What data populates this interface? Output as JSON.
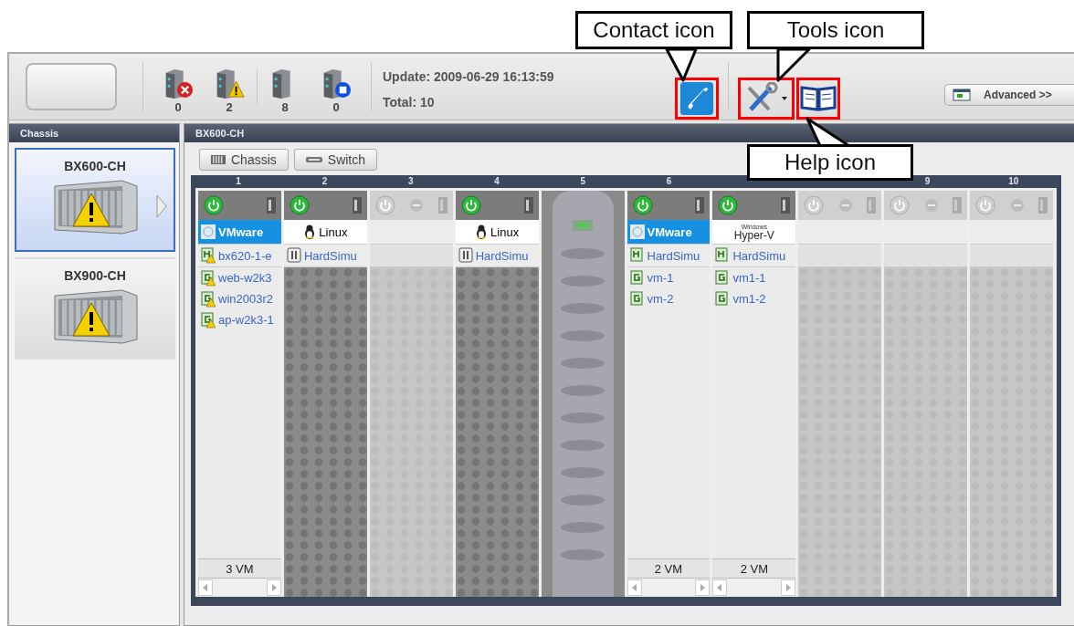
{
  "callouts": [
    {
      "text": "Contact icon"
    },
    {
      "text": "Tools icon"
    },
    {
      "text": "Help icon"
    }
  ],
  "toolbar": {
    "status_counts": [
      {
        "kind": "error",
        "count": "0"
      },
      {
        "kind": "warning",
        "count": "2"
      },
      {
        "kind": "normal",
        "count": "8"
      },
      {
        "kind": "stopped",
        "count": "0"
      }
    ],
    "update": "Update: 2009-06-29 16:13:59",
    "total": "Total: 10",
    "advanced_button": "Advanced >>"
  },
  "sidebar": {
    "title": "Chassis",
    "items": [
      {
        "label": "BX600-CH",
        "selected": true,
        "warning": true
      },
      {
        "label": "BX900-CH",
        "selected": false,
        "warning": true
      }
    ]
  },
  "main": {
    "title": "BX600-CH",
    "view_buttons": [
      {
        "kind": "chassis",
        "label": "Chassis"
      },
      {
        "kind": "switch",
        "label": "Switch"
      }
    ],
    "slots": [
      {
        "number": "1",
        "kind": "server",
        "powered": true,
        "os": {
          "kind": "vmware",
          "label": "VMware"
        },
        "host": {
          "kind": "hypervisor",
          "label": "bx620-1-e",
          "warning": true
        },
        "guests": [
          {
            "label": "web-w2k3",
            "warning": true
          },
          {
            "label": "win2003r2",
            "warning": true
          },
          {
            "label": "ap-w2k3-1",
            "warning": true
          }
        ],
        "vm_count": "3 VM"
      },
      {
        "number": "2",
        "kind": "server",
        "powered": true,
        "os": {
          "kind": "linux",
          "label": "Linux"
        },
        "host": {
          "kind": "physical",
          "label": "HardSimu",
          "warning": false
        }
      },
      {
        "number": "3",
        "kind": "server",
        "powered": false
      },
      {
        "number": "4",
        "kind": "server",
        "powered": true,
        "os": {
          "kind": "linux",
          "label": "Linux"
        },
        "host": {
          "kind": "physical",
          "label": "HardSimu",
          "warning": false
        }
      },
      {
        "number": "5",
        "kind": "switch",
        "status": "ON"
      },
      {
        "number": "6",
        "kind": "server",
        "powered": true,
        "os": {
          "kind": "vmware",
          "label": "VMware"
        },
        "host": {
          "kind": "hypervisor",
          "label": "HardSimu",
          "warning": false
        },
        "guests": [
          {
            "label": "vm-1",
            "warning": false
          },
          {
            "label": "vm-2",
            "warning": false
          }
        ],
        "vm_count": "2 VM"
      },
      {
        "kind": "server",
        "powered": true,
        "os": {
          "kind": "hyperv",
          "vendor": "Windows",
          "label": "Hyper-V"
        },
        "host": {
          "kind": "hypervisor",
          "label": "HardSimu",
          "warning": false
        },
        "guests": [
          {
            "label": "vm1-1",
            "warning": false
          },
          {
            "label": "vm1-2",
            "warning": false
          }
        ],
        "vm_count": "2 VM"
      },
      {
        "kind": "server",
        "powered": false
      },
      {
        "number": "9",
        "kind": "server",
        "powered": false
      },
      {
        "number": "10",
        "kind": "server",
        "powered": false
      }
    ]
  }
}
